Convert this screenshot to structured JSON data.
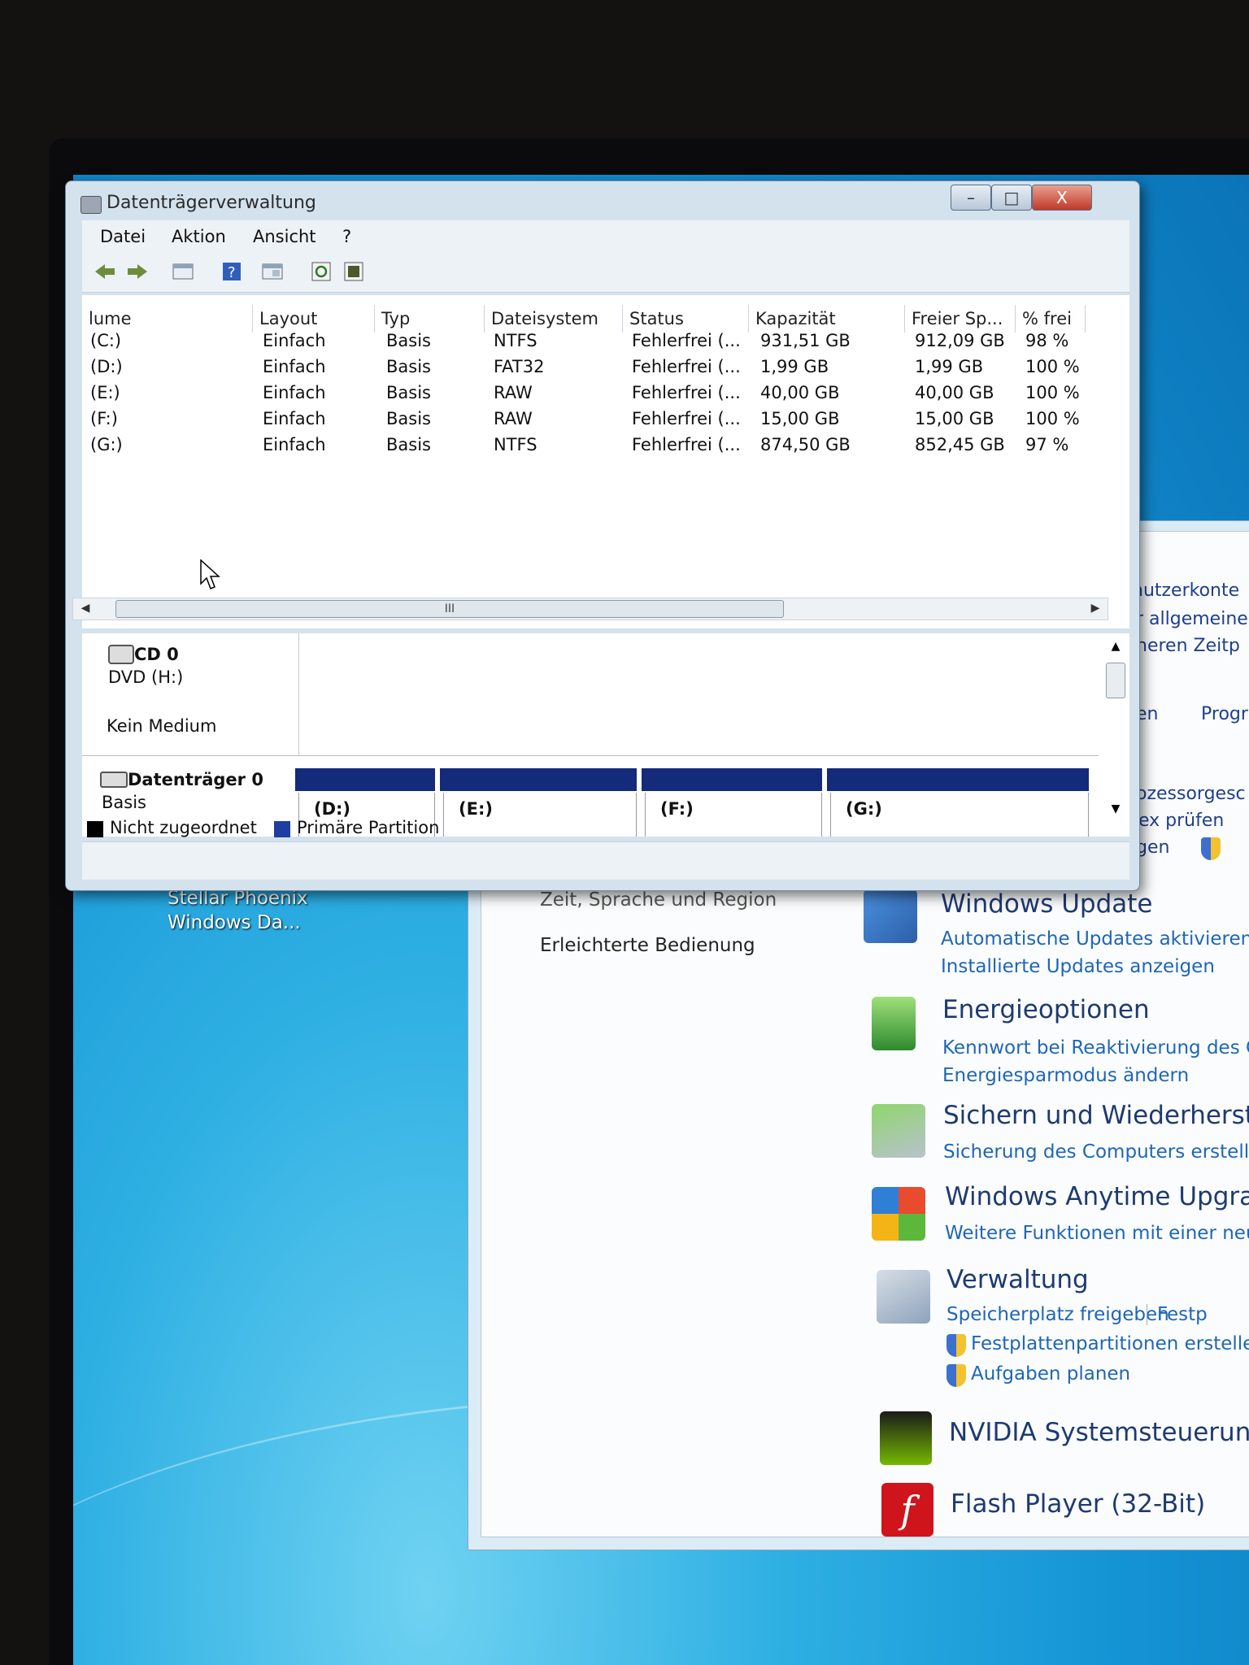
{
  "desktop": {
    "icon_label_line1": "Stellar Phoenix",
    "icon_label_line2": "Windows Da..."
  },
  "control_panel": {
    "partial_right_texts": [
      "nutzerkonte",
      "r allgemeine",
      "heren Zeitp",
      "en",
      "Progr",
      "ozessorgesc",
      "ex prüfen",
      "gen"
    ],
    "left_links": [
      "Zeit, Sprache und Region",
      "Erleichterte Bedienung"
    ],
    "items": [
      {
        "title": "Windows Update",
        "links": [
          "Automatische Updates aktivieren o",
          "Installierte Updates anzeigen"
        ],
        "icon": "windows-update-icon"
      },
      {
        "title": "Energieoptionen",
        "links": [
          "Kennwort bei Reaktivierung des C",
          "Energiesparmodus ändern"
        ],
        "icon": "battery-icon"
      },
      {
        "title": "Sichern und Wiederherste",
        "links": [
          "Sicherung des Computers erstelle"
        ],
        "icon": "backup-icon"
      },
      {
        "title": "Windows Anytime Upgra",
        "links": [
          "Weitere Funktionen mit einer neu"
        ],
        "icon": "windows-logo-icon"
      },
      {
        "title": "Verwaltung",
        "links": [
          "Speicherplatz freigeben",
          "Festp",
          "Festplattenpartitionen erstelle",
          "Aufgaben planen"
        ],
        "icon": "admin-tools-icon"
      },
      {
        "title": "NVIDIA Systemsteuerun",
        "links": [],
        "icon": "nvidia-icon"
      },
      {
        "title": "Flash Player (32-Bit)",
        "links": [],
        "icon": "flash-icon"
      }
    ]
  },
  "disk_mgmt": {
    "title": "Datenträgerverwaltung",
    "window_buttons": {
      "minimize": "–",
      "maximize": "□",
      "close": "X"
    },
    "menu": [
      "Datei",
      "Aktion",
      "Ansicht",
      "?"
    ],
    "columns": [
      "lume",
      "Layout",
      "Typ",
      "Dateisystem",
      "Status",
      "Kapazität",
      "Freier Sp...",
      "% frei"
    ],
    "rows": [
      [
        "(C:)",
        "Einfach",
        "Basis",
        "NTFS",
        "Fehlerfrei (...",
        "931,51 GB",
        "912,09 GB",
        "98 %"
      ],
      [
        "(D:)",
        "Einfach",
        "Basis",
        "FAT32",
        "Fehlerfrei (...",
        "1,99 GB",
        "1,99 GB",
        "100 %"
      ],
      [
        "(E:)",
        "Einfach",
        "Basis",
        "RAW",
        "Fehlerfrei (...",
        "40,00 GB",
        "40,00 GB",
        "100 %"
      ],
      [
        "(F:)",
        "Einfach",
        "Basis",
        "RAW",
        "Fehlerfrei (...",
        "15,00 GB",
        "15,00 GB",
        "100 %"
      ],
      [
        "(G:)",
        "Einfach",
        "Basis",
        "NTFS",
        "Fehlerfrei (...",
        "874,50 GB",
        "852,45 GB",
        "97 %"
      ]
    ],
    "hscroll_grip": "III",
    "cd": {
      "name": "CD 0",
      "drive": "DVD (H:)",
      "media": "Kein Medium"
    },
    "disk0": {
      "name": "Datenträger 0",
      "type": "Basis",
      "partitions": [
        "(D:)",
        "(E:)",
        "(F:)",
        "(G:)"
      ]
    },
    "legend": {
      "unallocated": "Nicht zugeordnet",
      "primary": "Primäre Partition",
      "unallocated_color": "#000000",
      "primary_color": "#1f3f9f"
    }
  }
}
